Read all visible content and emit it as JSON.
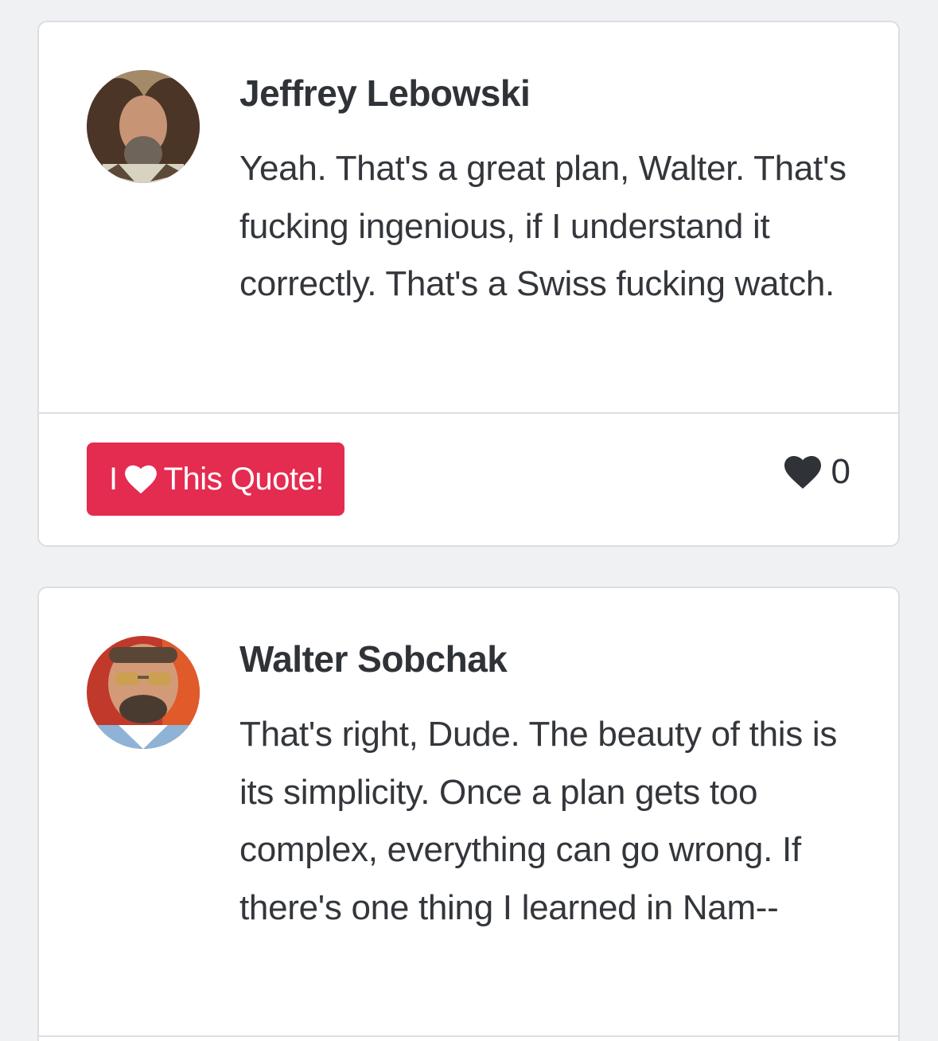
{
  "quotes": [
    {
      "author": "Jeffrey Lebowski",
      "text": "Yeah. That's a great plan, Walter. That's fucking ingenious, if I understand it correctly. That's a Swiss fucking watch.",
      "love_button": {
        "prefix": "I",
        "icon": "heart-icon",
        "suffix": "This Quote!"
      },
      "likes": "0"
    },
    {
      "author": "Walter Sobchak",
      "text": "That's right, Dude. The beauty of this is its simplicity. Once a plan gets too complex, everything can go wrong. If there's one thing I learned in Nam--"
    }
  ],
  "colors": {
    "background": "#f0f1f3",
    "card": "#ffffff",
    "border": "#dcdee2",
    "accent": "#e42b50",
    "text": "#33363b"
  }
}
